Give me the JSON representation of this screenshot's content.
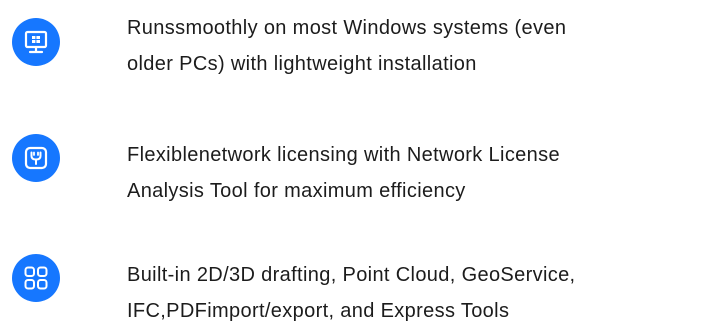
{
  "colors": {
    "accent": "#1677ff",
    "icon_glyph": "#ffffff",
    "text": "#1c1c1c",
    "background": "#ffffff"
  },
  "features": [
    {
      "icon": "windows-monitor-icon",
      "lines": [
        "Runssmoothly on most Windows systems (even",
        "older PCs) with lightweight installation"
      ]
    },
    {
      "icon": "network-license-icon",
      "lines": [
        "Flexiblenetwork licensing with Network License",
        "Analysis Tool for maximum  efficiency"
      ]
    },
    {
      "icon": "grid-apps-icon",
      "lines": [
        "Built-in 2D/3D drafting, Point Cloud, GeoService,",
        "IFC,PDFimport/export,  and Express Tools"
      ]
    }
  ]
}
